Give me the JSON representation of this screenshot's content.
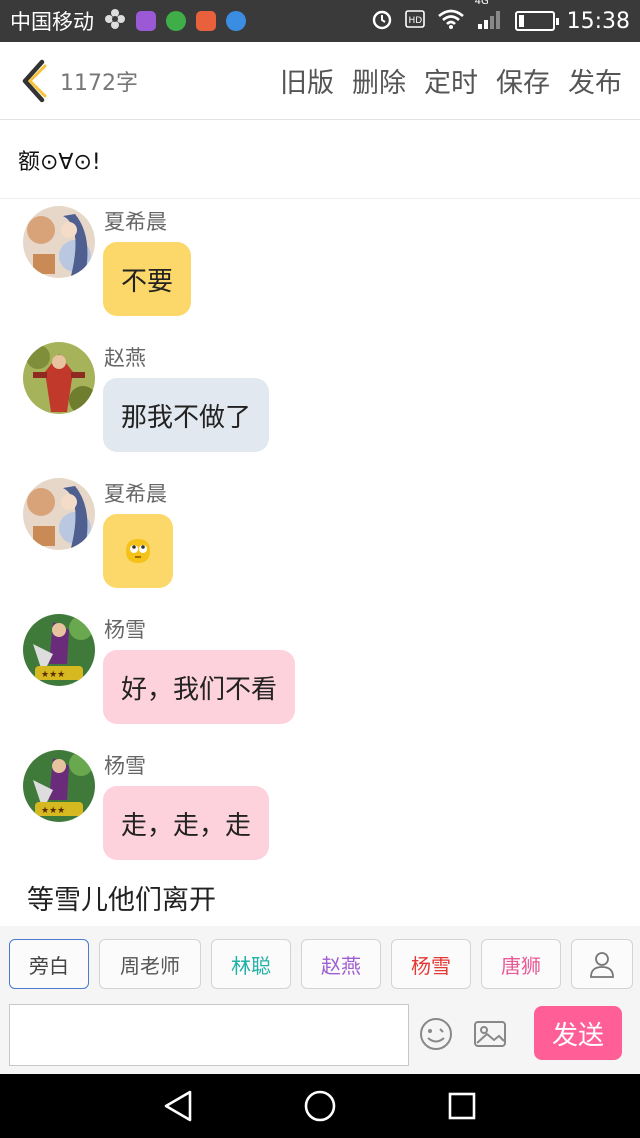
{
  "status_bar": {
    "carrier": "中国移动",
    "network": "4G",
    "time": "15:38",
    "battery_level": 0.15,
    "icons": [
      "flower-icon",
      "app-purple-icon",
      "app-green-icon",
      "app-orange-icon",
      "app-blue-icon",
      "alarm-icon",
      "hd-icon",
      "wifi-icon",
      "signal-icon",
      "battery-icon"
    ]
  },
  "header": {
    "back_icon": "chevron-left-icon",
    "word_count": "1172字",
    "actions": [
      "旧版",
      "删除",
      "定时",
      "保存",
      "发布"
    ]
  },
  "title": "额⊙∀⊙!",
  "messages": [
    {
      "name": "夏希晨",
      "text": "不要",
      "bubble_color": "#fcd86a",
      "avatar": "avatar-anime-girl"
    },
    {
      "name": "赵燕",
      "text": "那我不做了",
      "bubble_color": "#e1e8ef",
      "avatar": "avatar-red-warrior"
    },
    {
      "name": "夏希晨",
      "text": "",
      "emoji": "rolling-eyes-emoji",
      "bubble_color": "#fcd86a",
      "avatar": "avatar-anime-girl"
    },
    {
      "name": "杨雪",
      "text": "好，我们不看",
      "bubble_color": "#fdd2dc",
      "avatar": "avatar-purple-hero"
    },
    {
      "name": "杨雪",
      "text": "走，走，走",
      "bubble_color": "#fdd2dc",
      "avatar": "avatar-purple-hero"
    }
  ],
  "narration": "等雪儿他们离开",
  "roles": [
    {
      "label": "旁白",
      "color": "#444444",
      "active": true
    },
    {
      "label": "周老师",
      "color": "#555555",
      "active": false
    },
    {
      "label": "林聪",
      "color": "#22b1a7",
      "active": false
    },
    {
      "label": "赵燕",
      "color": "#a05dd0",
      "active": false
    },
    {
      "label": "杨雪",
      "color": "#e53935",
      "active": false
    },
    {
      "label": "唐狮",
      "color": "#e85a97",
      "active": false
    }
  ],
  "input": {
    "placeholder": "",
    "value": "",
    "send_label": "发送"
  },
  "colors": {
    "accent": "#ff5e97",
    "active_role_border": "#4a7bd0"
  }
}
